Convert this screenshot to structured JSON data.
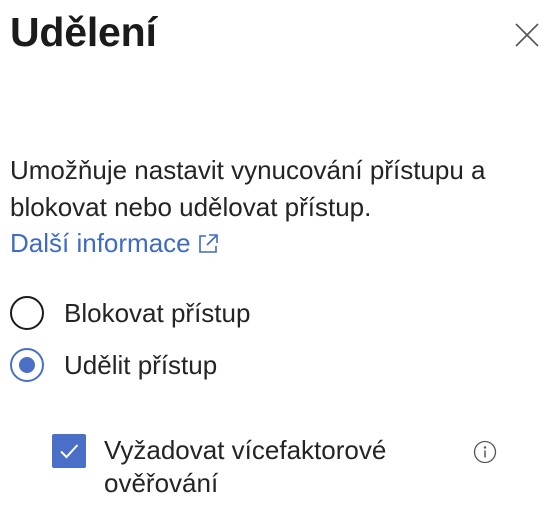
{
  "panel": {
    "title": "Udělení",
    "close_icon": "close-icon"
  },
  "description": {
    "text": "Umožňuje nastavit vynucování přístupu a blokovat nebo udělovat přístup.",
    "link_label": "Další informace",
    "link_icon": "external-link-icon"
  },
  "access_options": [
    {
      "label": "Blokovat přístup",
      "selected": false
    },
    {
      "label": "Udělit přístup",
      "selected": true
    }
  ],
  "requirements": [
    {
      "label": "Vyžadovat vícefaktorové ověřování",
      "checked": true,
      "info_icon": "info-icon"
    }
  ],
  "colors": {
    "accent": "#4a6fc7",
    "link": "#3f6bc4",
    "text": "#242424"
  }
}
